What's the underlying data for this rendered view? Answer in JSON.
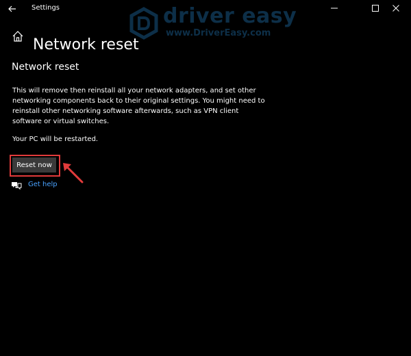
{
  "window": {
    "title": "Settings",
    "controls": {
      "minimize": "minimize",
      "maximize": "maximize",
      "close": "close"
    }
  },
  "watermark": {
    "brand": "driver easy",
    "url": "www.DriverEasy.com"
  },
  "header": {
    "page_title": "Network reset"
  },
  "content": {
    "section_title": "Network reset",
    "description": "This will remove then reinstall all your network adapters, and set other networking components back to their original settings. You might need to reinstall other networking software afterwards, such as VPN client software or virtual switches.",
    "restart_note": "Your PC will be restarted.",
    "reset_button_label": "Reset now",
    "get_help_label": "Get help"
  },
  "colors": {
    "background": "#000000",
    "text": "#ffffff",
    "button_bg": "#3a3a3a",
    "link": "#4aa3ff",
    "highlight": "#e23b3b",
    "watermark": "#1b5e8f"
  },
  "icons": [
    "back-arrow-icon",
    "home-icon",
    "help-chat-icon",
    "minimize-icon",
    "maximize-icon",
    "close-icon",
    "driver-easy-logo"
  ]
}
